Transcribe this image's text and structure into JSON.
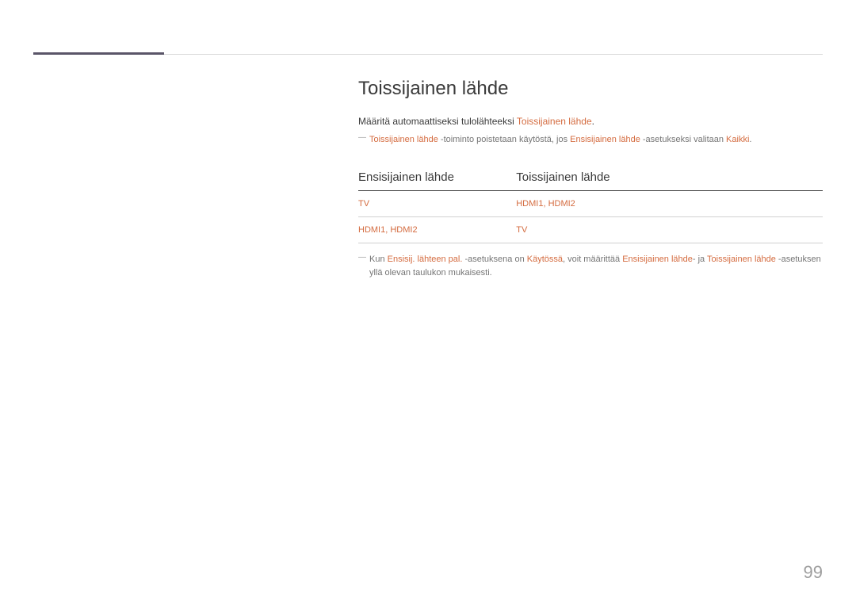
{
  "title": "Toissijainen lähde",
  "intro": {
    "prefix": "Määritä automaattiseksi tulolähteeksi ",
    "highlight": "Toissijainen lähde",
    "suffix": "."
  },
  "note1": {
    "hl1": "Toissijainen lähde",
    "t1": " -toiminto poistetaan käytöstä, jos ",
    "hl2": "Ensisijainen lähde",
    "t2": " -asetukseksi valitaan ",
    "hl3": "Kaikki",
    "t3": "."
  },
  "table": {
    "headers": {
      "col1": "Ensisijainen lähde",
      "col2": "Toissijainen lähde"
    },
    "rows": [
      {
        "c1": "TV",
        "c2": "HDMI1, HDMI2"
      },
      {
        "c1": "HDMI1, HDMI2",
        "c2": "TV"
      }
    ]
  },
  "note2": {
    "t1": "Kun ",
    "hl1": "Ensisij. lähteen pal.",
    "t2": " -asetuksena on ",
    "hl2": "Käytössä",
    "t3": ", voit määrittää ",
    "hl3": "Ensisijainen lähde",
    "t4": "- ja ",
    "hl4": "Toissijainen lähde",
    "t5": " -asetuksen yllä olevan taulukon mukaisesti."
  },
  "pageNumber": "99"
}
